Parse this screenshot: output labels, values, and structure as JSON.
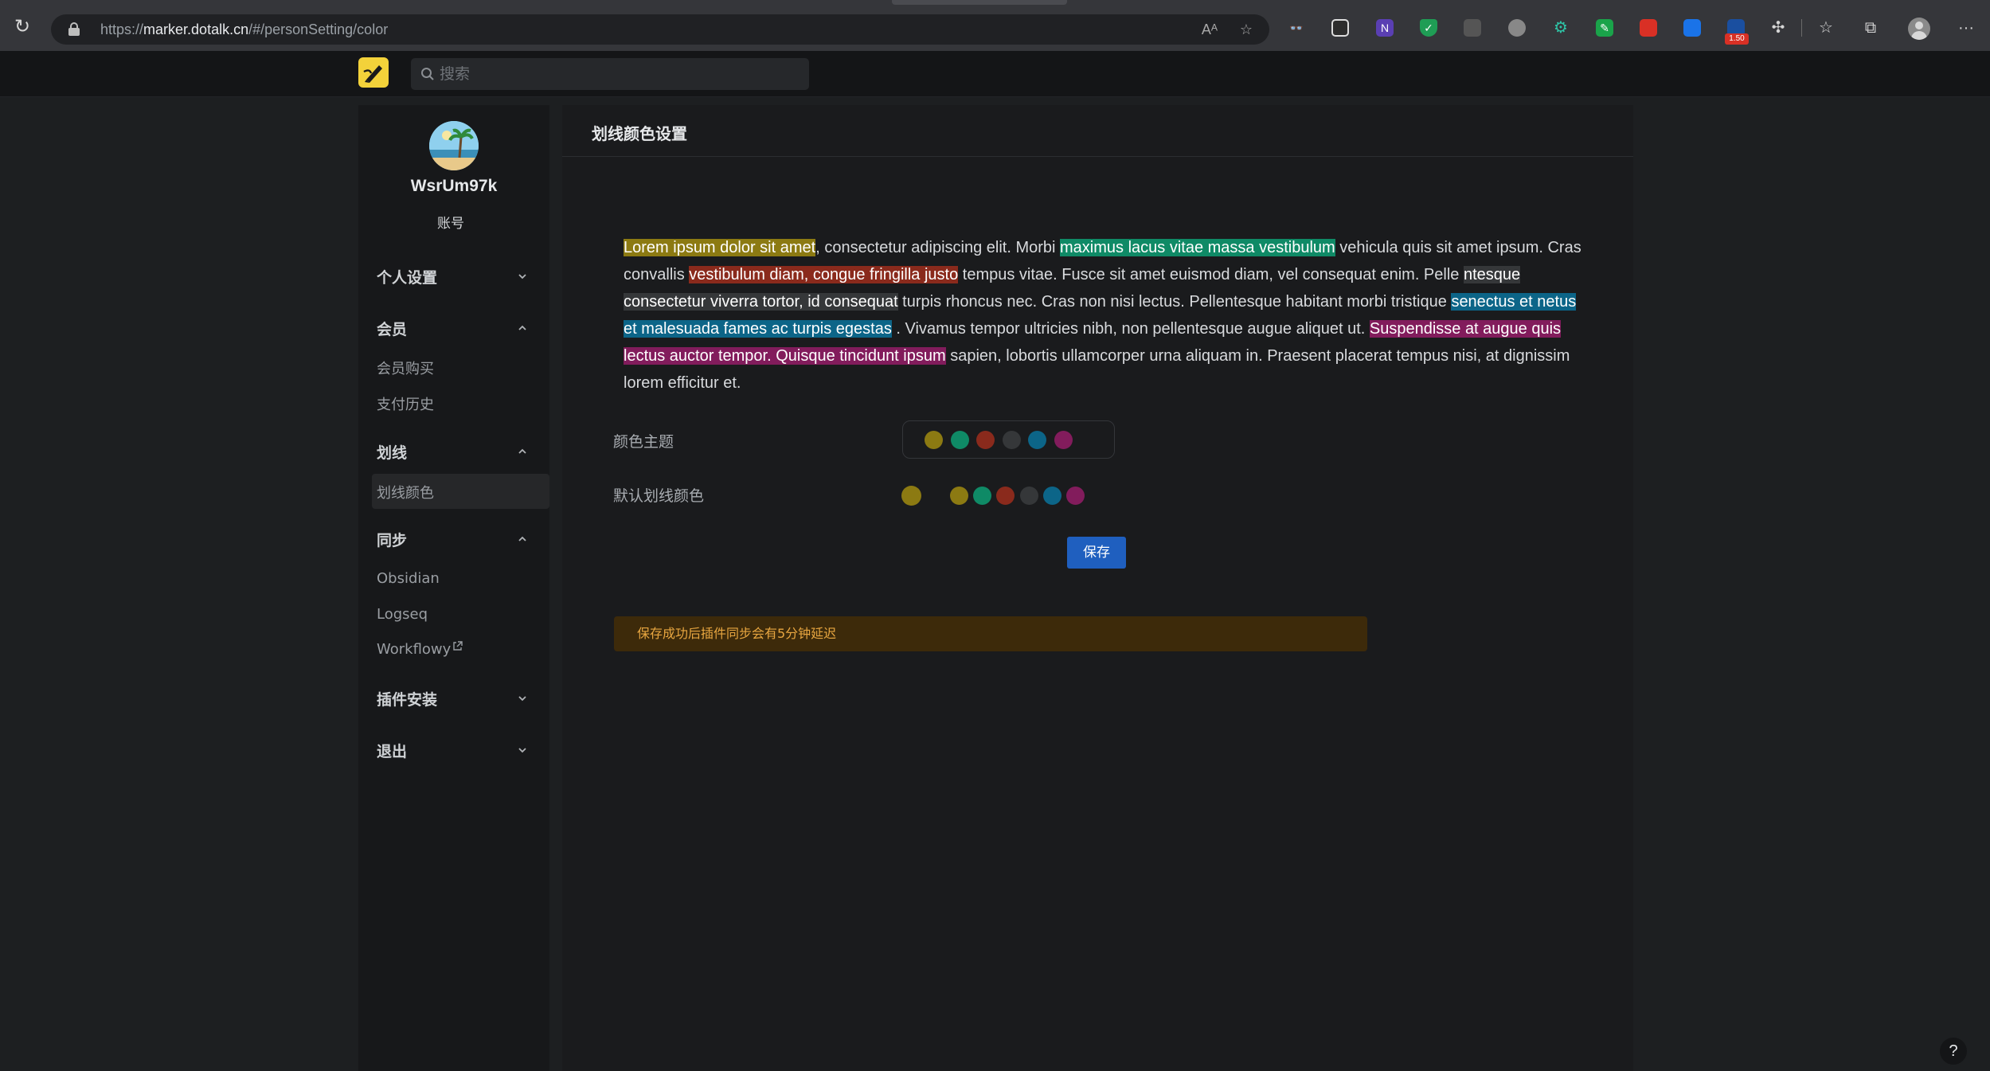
{
  "browser": {
    "url_scheme": "https://",
    "url_host": "marker.dotalk.cn",
    "url_path": "/#/personSetting/color",
    "extension_badge": "1.50",
    "more_label": "···"
  },
  "header": {
    "search_placeholder": "搜索"
  },
  "sidebar": {
    "username": "WsrUm97k",
    "account_label": "账号",
    "sections": [
      {
        "label": "个人设置",
        "expanded": false,
        "items": []
      },
      {
        "label": "会员",
        "expanded": true,
        "items": [
          "会员购买",
          "支付历史"
        ]
      },
      {
        "label": "划线",
        "expanded": true,
        "items": [
          "划线颜色"
        ]
      },
      {
        "label": "同步",
        "expanded": true,
        "items": [
          "Obsidian",
          "Logseq",
          "Workflowy"
        ]
      },
      {
        "label": "插件安装",
        "expanded": false,
        "items": []
      },
      {
        "label": "退出",
        "expanded": false,
        "items": []
      }
    ],
    "active_item": "划线颜色"
  },
  "main": {
    "title": "划线颜色设置",
    "sample": {
      "hl1": "Lorem ipsum dolor sit amet",
      "t1": ", consectetur adipiscing elit. Morbi ",
      "hl2": "maximus lacus vitae massa vestibulum",
      "t2": " vehicula quis sit amet ipsum. Cras convallis ",
      "hl3": "vestibulum diam, congue fringilla justo",
      "t3": " tempus vitae. Fusce sit amet euismod diam, vel consequat enim. Pelle ",
      "hl4": "ntesque consectetur viverra tortor, id consequat",
      "t4": " turpis rhoncus nec. Cras non nisi lectus. Pellentesque habitant morbi tristique ",
      "hl5": "senectus et netus et malesuada fames ac turpis egestas",
      "t5": " . Vivamus tempor ultricies nibh, non pellentesque augue aliquet ut. ",
      "hl6": "Suspendisse at augue quis lectus auctor tempor. Quisque tincidunt ipsum",
      "t6": " sapien, lobortis ullamcorper urna aliquam in. Praesent placerat tempus nisi, at dignissim lorem efficitur et."
    },
    "theme_label": "颜色主题",
    "default_color_label": "默认划线颜色",
    "theme_colors": [
      "#8c7a12",
      "#0f8a66",
      "#8a2a1c",
      "#353739",
      "#0c6588",
      "#821c5c"
    ],
    "default_color": "#8c7a12",
    "save_label": "保存",
    "notice": "保存成功后插件同步会有5分钟延迟"
  },
  "help_label": "?"
}
